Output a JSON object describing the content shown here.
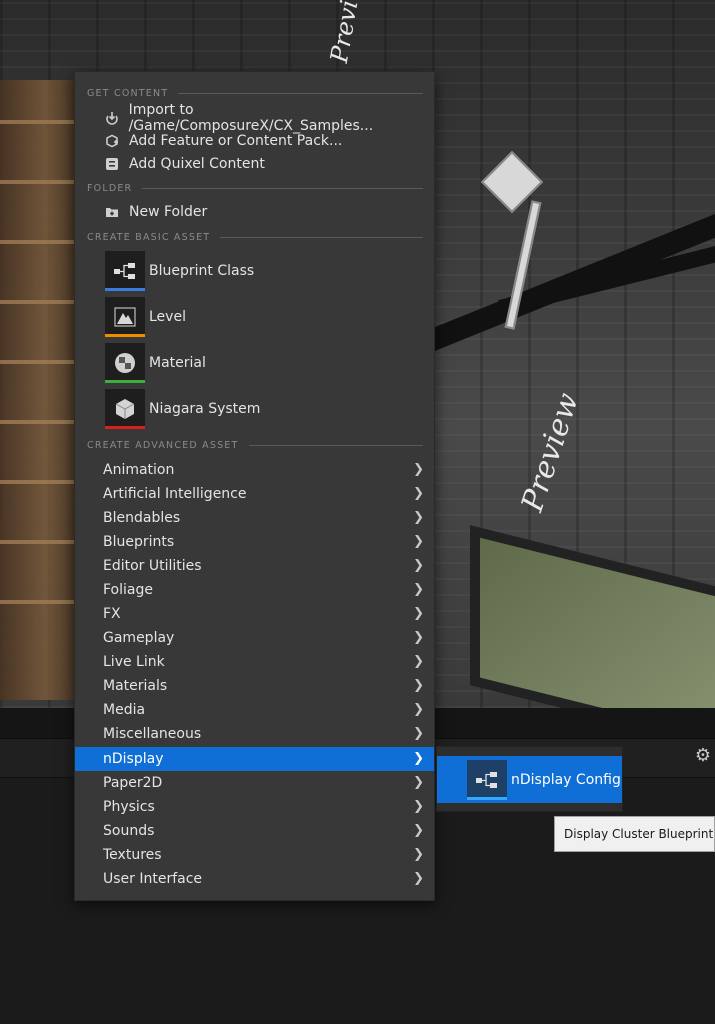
{
  "viewport": {
    "preview_texts": [
      "Preview",
      "Preview"
    ]
  },
  "menu": {
    "sections": {
      "get_content": "GET CONTENT",
      "folder": "FOLDER",
      "basic_asset": "CREATE BASIC ASSET",
      "advanced_asset": "CREATE ADVANCED ASSET"
    },
    "get_content_items": [
      {
        "label": "Import to /Game/ComposureX/CX_Samples...",
        "icon": "import-icon"
      },
      {
        "label": "Add Feature or Content Pack...",
        "icon": "feature-pack-icon"
      },
      {
        "label": "Add Quixel Content",
        "icon": "quixel-icon"
      }
    ],
    "folder_items": [
      {
        "label": "New Folder",
        "icon": "new-folder-icon"
      }
    ],
    "basic_assets": [
      {
        "label": "Blueprint Class",
        "icon": "blueprint-icon",
        "color": "#3a7bdc"
      },
      {
        "label": "Level",
        "icon": "level-icon",
        "color": "#f08c00"
      },
      {
        "label": "Material",
        "icon": "material-icon",
        "color": "#3fae3f"
      },
      {
        "label": "Niagara System",
        "icon": "niagara-icon",
        "color": "#d42020"
      }
    ],
    "advanced_assets": [
      "Animation",
      "Artificial Intelligence",
      "Blendables",
      "Blueprints",
      "Editor Utilities",
      "Foliage",
      "FX",
      "Gameplay",
      "Live Link",
      "Materials",
      "Media",
      "Miscellaneous",
      "nDisplay",
      "Paper2D",
      "Physics",
      "Sounds",
      "Textures",
      "User Interface"
    ],
    "active_item": "nDisplay",
    "highlight_color": "#0f6fd6"
  },
  "submenu": {
    "item_label": "nDisplay Config",
    "icon": "ndisplay-config-icon"
  },
  "tooltip": {
    "text": "Display Cluster Blueprint"
  },
  "toolbar": {
    "settings_icon": "gear-icon"
  }
}
